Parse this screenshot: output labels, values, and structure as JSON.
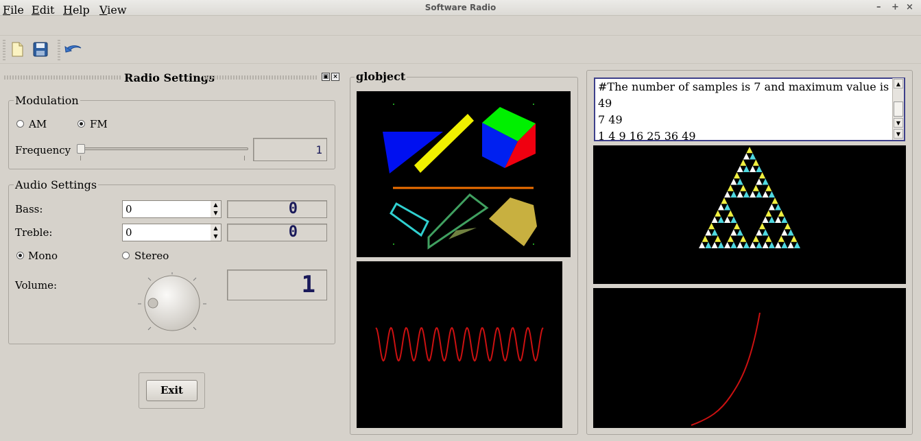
{
  "window": {
    "title": "Software Radio",
    "min": "–",
    "max": "+",
    "close": "×"
  },
  "menu": {
    "file": {
      "accel": "F",
      "rest": "ile"
    },
    "edit": {
      "accel": "E",
      "rest": "dit"
    },
    "help": {
      "accel": "H",
      "rest": "elp"
    },
    "view": {
      "accel": "V",
      "rest": "iew"
    }
  },
  "toolbar": {
    "icons": [
      "new-file-icon",
      "save-icon",
      "undo-icon"
    ]
  },
  "radio_dock": {
    "title": "Radio Settings",
    "modulation": {
      "label": "Modulation",
      "am": "AM",
      "fm": "FM",
      "selected": "FM",
      "frequency_label": "Frequency",
      "frequency_value": "1"
    },
    "audio": {
      "label": "Audio Settings",
      "bass_label": "Bass:",
      "bass_value": "0",
      "bass_lcd": "0",
      "treble_label": "Treble:",
      "treble_value": "0",
      "treble_lcd": "0",
      "mono": "Mono",
      "stereo": "Stereo",
      "selected": "Mono",
      "volume_label": "Volume:",
      "volume_lcd": "1"
    },
    "exit_label": "Exit"
  },
  "globject": {
    "title": "globject"
  },
  "right_panel": {
    "text_lines": [
      "#The number of samples is 7 and maximum value is",
      "49",
      "7 49",
      "1 4 9 16 25 36 49"
    ]
  },
  "colors": {
    "background": "#d6d2cb",
    "accent": "#3d3f8a",
    "wave": "#cc1111"
  }
}
